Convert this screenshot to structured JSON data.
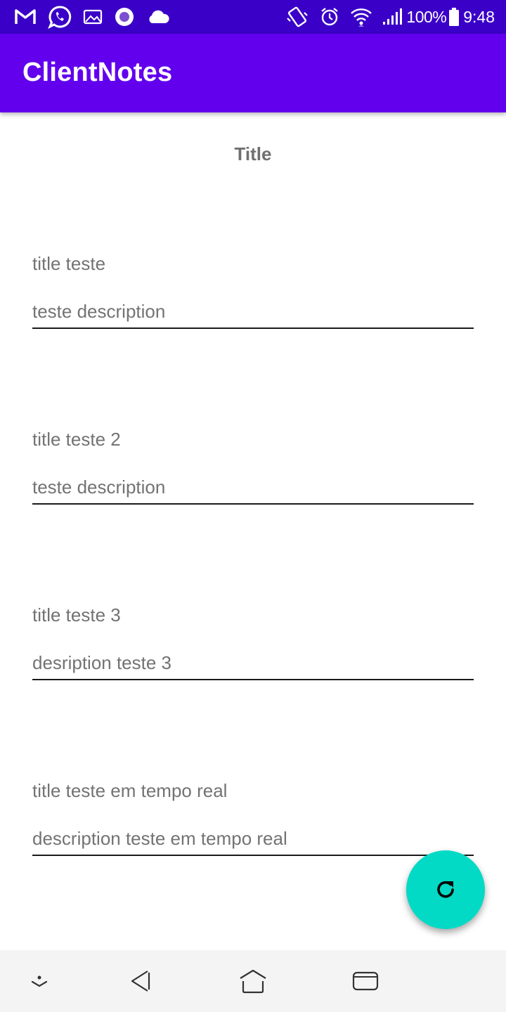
{
  "status_bar": {
    "left_icons": [
      "gmail-icon",
      "whatsapp-icon",
      "gallery-icon",
      "circle-app-icon",
      "cloud-icon"
    ],
    "right_icons": [
      "vibrate-icon",
      "alarm-icon",
      "wifi-icon",
      "signal-icon",
      "battery-icon"
    ],
    "battery": "100%",
    "time": "9:48"
  },
  "app_bar": {
    "title": "ClientNotes",
    "color": "#6200ee"
  },
  "list": {
    "header": "Title",
    "notes": [
      {
        "title": "title teste",
        "description": "teste description"
      },
      {
        "title": "title teste 2",
        "description": "teste description"
      },
      {
        "title": "title teste 3",
        "description": "desription teste 3"
      },
      {
        "title": "title teste em tempo real",
        "description": "description teste em tempo real"
      }
    ]
  },
  "fab": {
    "icon": "refresh-icon",
    "color": "#03dac5"
  },
  "nav_bar": {
    "icons": [
      "hide-keyboard-icon",
      "back-icon",
      "home-icon",
      "recents-icon"
    ]
  }
}
